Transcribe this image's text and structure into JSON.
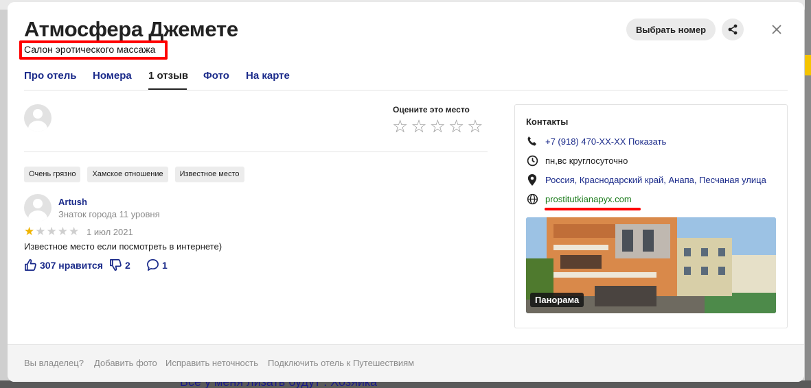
{
  "modal": {
    "title": "Атмосфера Джемете",
    "subtitle": "Салон эротического массажа",
    "choose_room_label": "Выбрать номер"
  },
  "tabs": [
    {
      "label": "Про отель",
      "active": false
    },
    {
      "label": "Номера",
      "active": false
    },
    {
      "label": "1 отзыв",
      "active": true
    },
    {
      "label": "Фото",
      "active": false
    },
    {
      "label": "На карте",
      "active": false
    }
  ],
  "rate": {
    "label": "Оцените это место",
    "stars_total": 5
  },
  "tags": [
    "Очень грязно",
    "Хамское отношение",
    "Известное место"
  ],
  "review": {
    "author": "Artush",
    "author_level": "Знаток города 11 уровня",
    "rating": 1,
    "rating_max": 5,
    "date": "1 июл 2021",
    "text": "Известное место если посмотреть в интернете)",
    "likes": "307 нравится",
    "dislikes": "2",
    "comments": "1"
  },
  "contacts": {
    "title": "Контакты",
    "phone": "+7 (918) 470-XX-XX Показать",
    "hours": "пн,вс круглосуточно",
    "address": "Россия, Краснодарский край, Анапа, Песчаная улица",
    "website": "prostitutkianapyx.com",
    "panorama_label": "Панорама"
  },
  "footer": {
    "links": [
      "Вы владелец?",
      "Добавить фото",
      "Исправить неточность",
      "Подключить отель к Путешествиям"
    ]
  },
  "background": {
    "bottom_text": "Все у меня лизать будут . Хозяйка"
  },
  "colors": {
    "link": "#1a2a8a",
    "highlight": "#ff0000",
    "star_on": "#f0b400",
    "website": "#1a7a1a"
  }
}
